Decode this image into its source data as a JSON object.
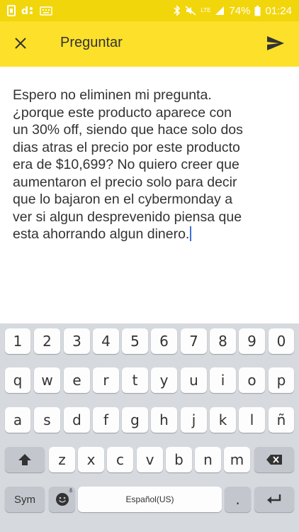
{
  "status_bar": {
    "left_icons": [
      "notification-d-icon",
      "notification-g-icon",
      "keyboard-icon"
    ],
    "right_icons": [
      "bluetooth-icon",
      "mute-icon",
      "lte-icon",
      "signal-icon",
      "battery-icon"
    ],
    "lte": "LTE",
    "battery": "74%",
    "time": "01:24"
  },
  "app_bar": {
    "title": "Preguntar",
    "close_icon": "close-icon",
    "send_icon": "send-icon",
    "background": "#fde02a"
  },
  "question": {
    "lines": [
      "Espero no eliminen mi pregunta.",
      "¿porque este producto aparece con",
      "un 30% off, siendo que hace solo dos",
      "dias atras el precio por este producto",
      "era de $10,699? No quiero creer que",
      "aumentaron el precio solo para decir",
      "que lo bajaron en el cybermonday a",
      "ver si algun desprevenido piensa que",
      "esta ahorrando algun dinero."
    ]
  },
  "keyboard": {
    "number_row": [
      "1",
      "2",
      "3",
      "4",
      "5",
      "6",
      "7",
      "8",
      "9",
      "0"
    ],
    "row1": [
      "q",
      "w",
      "e",
      "r",
      "t",
      "y",
      "u",
      "i",
      "o",
      "p"
    ],
    "row2": [
      "a",
      "s",
      "d",
      "f",
      "g",
      "h",
      "j",
      "k",
      "l",
      "ñ"
    ],
    "row3": [
      "z",
      "x",
      "c",
      "v",
      "b",
      "n",
      "m"
    ],
    "shift_icon": "shift-icon",
    "backspace_icon": "backspace-icon",
    "sym_label": "Sym",
    "emoji_icon": "emoji-icon",
    "mic_icon": "mic-icon",
    "space_label": "Español(US)",
    "period_label": ".",
    "enter_icon": "enter-icon"
  },
  "colors": {
    "status_bar": "#f2d60c",
    "keyboard_bg": "#d6d9de",
    "caret": "#3b6ee0"
  }
}
